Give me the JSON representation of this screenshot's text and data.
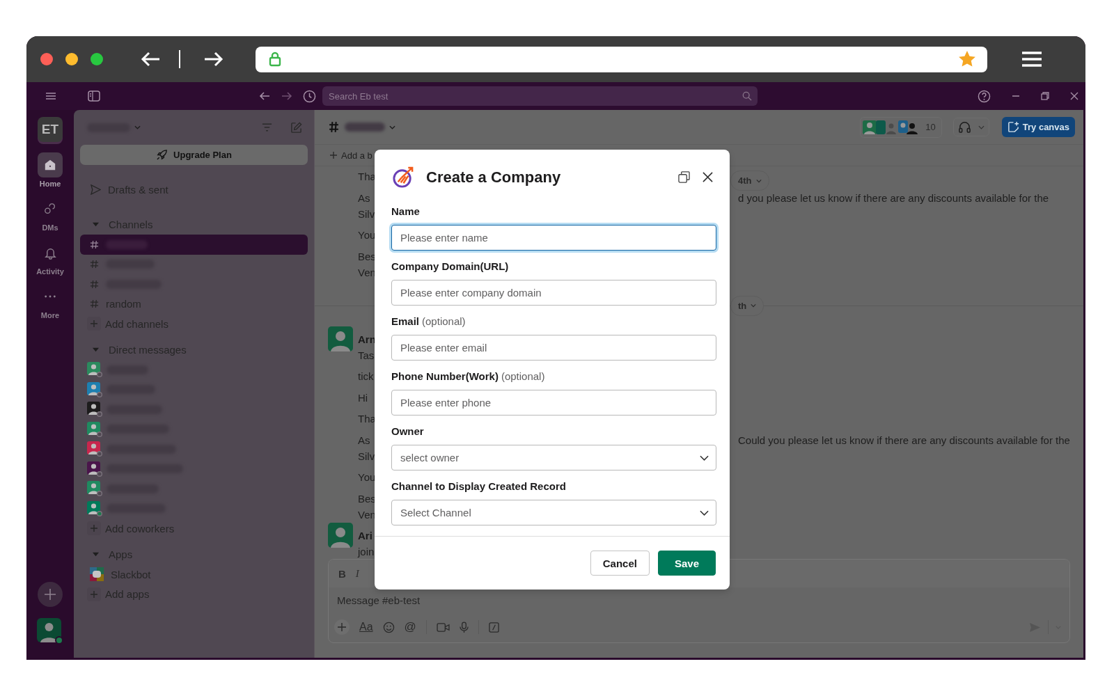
{
  "app_bar": {
    "search_placeholder": "Search Eb test"
  },
  "rail": {
    "workspace_initials": "ET",
    "items": [
      {
        "kind": "home",
        "label": "Home",
        "selected": true
      },
      {
        "kind": "dms",
        "label": "DMs",
        "selected": false
      },
      {
        "kind": "activity",
        "label": "Activity",
        "selected": false
      },
      {
        "kind": "more",
        "label": "More",
        "selected": false
      }
    ]
  },
  "sidebar": {
    "upgrade_button": "Upgrade Plan",
    "drafts": "Drafts & sent",
    "sections": [
      {
        "title": "Channels",
        "expanded": true,
        "items": [
          {
            "kind": "channel",
            "selected": true
          },
          {
            "kind": "channel",
            "selected": false
          },
          {
            "kind": "channel",
            "selected": false
          },
          {
            "kind": "channel",
            "label": "random",
            "selected": false
          },
          {
            "kind": "add",
            "label": "Add channels",
            "selected": false
          }
        ]
      },
      {
        "title": "Direct messages",
        "expanded": true,
        "items": [
          {
            "kind": "person",
            "color": "#2b8a5e",
            "online": false,
            "selected": false
          },
          {
            "kind": "person",
            "color": "#1d7fb0",
            "online": false,
            "selected": false
          },
          {
            "kind": "person",
            "color": "#1d1c1d",
            "online": false,
            "selected": false
          },
          {
            "kind": "person",
            "color": "#1f8a60",
            "online": false,
            "selected": false
          },
          {
            "kind": "person",
            "color": "#c8264d",
            "online": false,
            "selected": false
          },
          {
            "kind": "person",
            "color": "#4a154b",
            "online": false,
            "selected": false
          },
          {
            "kind": "person",
            "color": "#1f8a60",
            "online": false,
            "selected": false
          },
          {
            "kind": "person",
            "color": "#007a5a",
            "online": true,
            "selected": false
          },
          {
            "kind": "add",
            "label": "Add coworkers",
            "selected": false
          }
        ]
      },
      {
        "title": "Apps",
        "expanded": true,
        "items": [
          {
            "kind": "app",
            "label": "Slackbot",
            "selected": false
          },
          {
            "kind": "add",
            "label": "Add apps",
            "selected": false
          }
        ]
      }
    ]
  },
  "channel_header": {
    "member_count": "10",
    "canvas_button": "Try canvas"
  },
  "bookmarks": {
    "add_label": "Add a b"
  },
  "messages": [
    {
      "kind": "message",
      "date_pill": "4th",
      "paragraphs": [
        [
          {
            "left": "Tha"
          }
        ],
        [
          {
            "left": "As",
            "right": "d you please let us know if there are any discounts available for the"
          },
          {
            "left": "Silv"
          }
        ],
        [
          {
            "left": "You"
          }
        ],
        [
          {
            "left": "Bes"
          },
          {
            "left": "Ven"
          }
        ]
      ]
    },
    {
      "kind": "divider",
      "date_pill": "th"
    },
    {
      "kind": "message",
      "author": "Arn",
      "paragraphs": [
        [
          {
            "left": "Tas"
          }
        ],
        [
          {
            "left": "tick"
          }
        ],
        [
          {
            "left": "Hi"
          }
        ],
        [
          {
            "left": "Tha"
          }
        ],
        [
          {
            "left": "As",
            "right": "Could you please let us know if there are any discounts available for the"
          },
          {
            "left": "Silv"
          }
        ],
        [
          {
            "left": "You"
          }
        ],
        [
          {
            "left": "Bes"
          },
          {
            "left": "Ven"
          }
        ]
      ]
    },
    {
      "kind": "message",
      "author": "Ari",
      "paragraphs": [
        [
          {
            "left": "join"
          }
        ]
      ]
    }
  ],
  "composer": {
    "bold_key": "B",
    "italic_key": "I",
    "placeholder": "Message #eb-test",
    "format_key": "Aa",
    "mention_key": "@"
  },
  "modal": {
    "title": "Create a Company",
    "fields": [
      {
        "kind": "text",
        "label": "Name",
        "placeholder": "Please enter name",
        "focused": true
      },
      {
        "kind": "text",
        "label": "Company Domain(URL)",
        "placeholder": "Please enter company domain",
        "focused": false
      },
      {
        "kind": "text",
        "label": "Email",
        "note": "(optional)",
        "placeholder": "Please enter email",
        "focused": false
      },
      {
        "kind": "text",
        "label": "Phone Number(Work)",
        "note": "(optional)",
        "placeholder": "Please enter phone",
        "focused": false
      },
      {
        "kind": "select",
        "label": "Owner",
        "placeholder": "select owner",
        "focused": false
      },
      {
        "kind": "select",
        "label": "Channel to Display Created Record",
        "placeholder": "Select Channel",
        "focused": false
      }
    ],
    "buttons": [
      {
        "kind": "secondary",
        "label": "Cancel"
      },
      {
        "kind": "primary",
        "label": "Save"
      }
    ]
  }
}
